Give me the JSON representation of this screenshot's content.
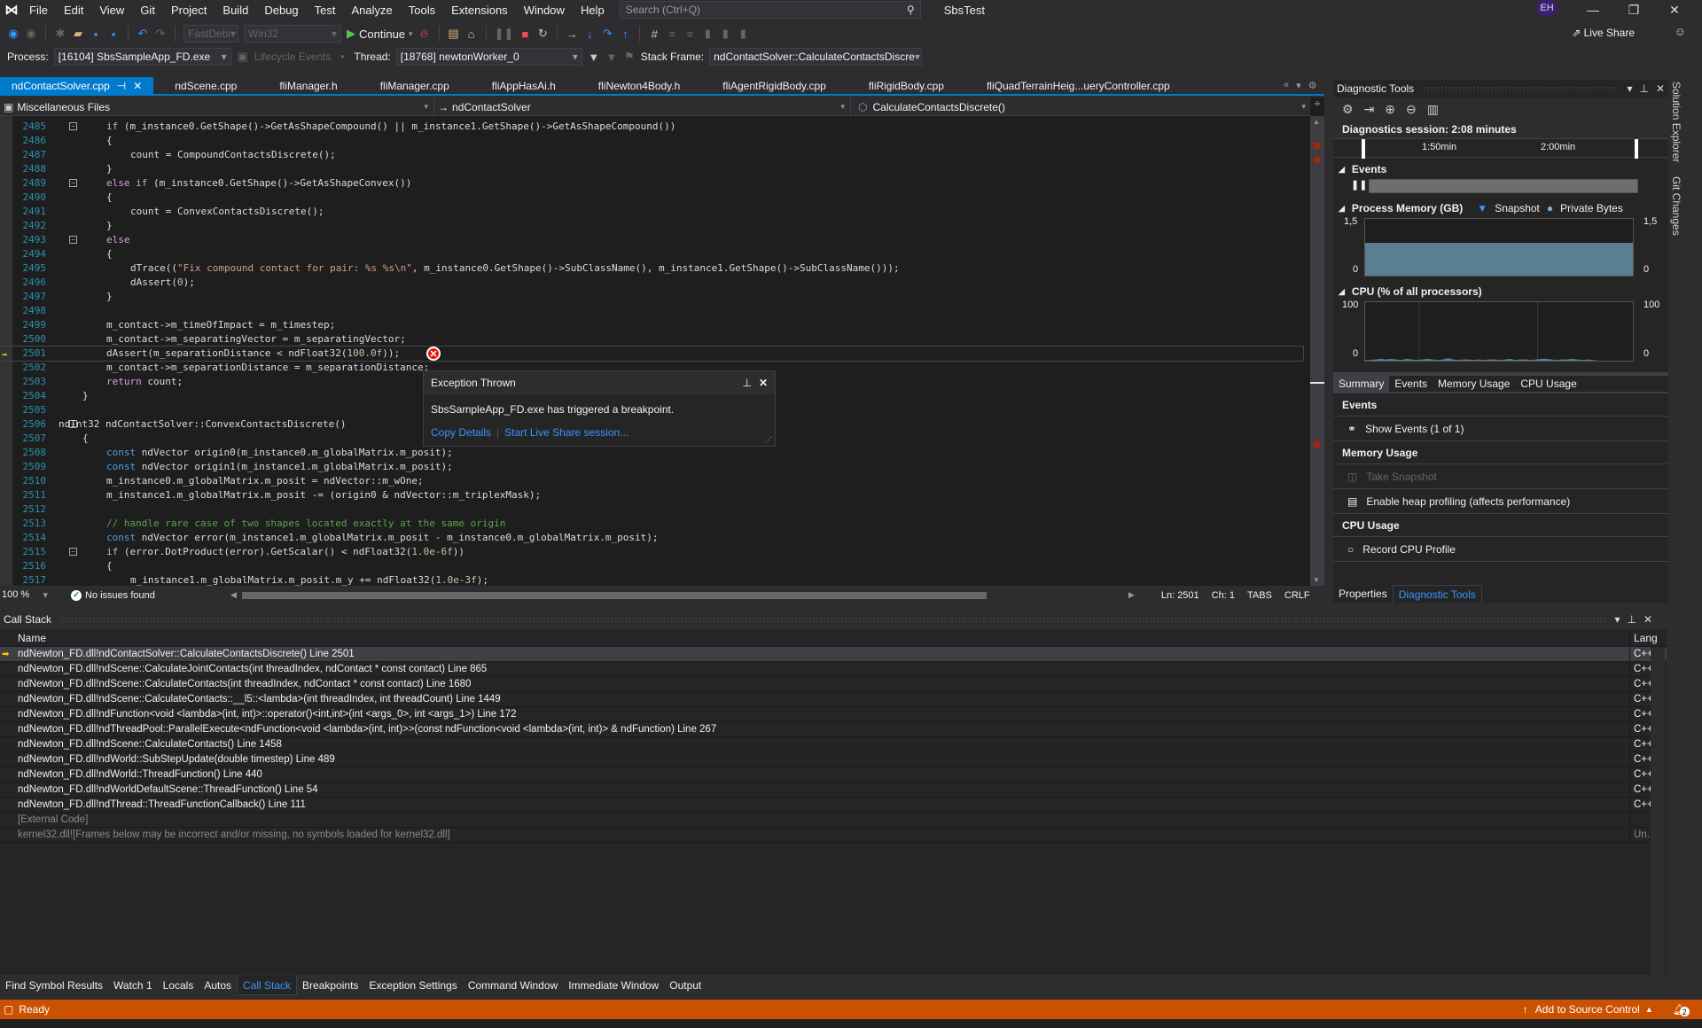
{
  "titlebar": {
    "menu": [
      "File",
      "Edit",
      "View",
      "Git",
      "Project",
      "Build",
      "Debug",
      "Test",
      "Analyze",
      "Tools",
      "Extensions",
      "Window",
      "Help"
    ],
    "search_placeholder": "Search (Ctrl+Q)",
    "solution_name": "SbsTest",
    "user_initials": "EH"
  },
  "toolbar": {
    "config": "FastDebi",
    "platform": "Win32",
    "continue_label": "Continue",
    "live_share": "Live Share",
    "process_label": "Process:",
    "process_value": "[16104] SbsSampleApp_FD.exe",
    "lifecycle_label": "Lifecycle Events",
    "thread_label": "Thread:",
    "thread_value": "[18768] newtonWorker_0",
    "stack_frame_label": "Stack Frame:",
    "stack_frame_value": "ndContactSolver::CalculateContactsDiscre"
  },
  "doc_tabs": [
    {
      "label": "ndContactSolver.cpp",
      "active": true
    },
    {
      "label": "ndScene.cpp"
    },
    {
      "label": "fliManager.h"
    },
    {
      "label": "fliManager.cpp"
    },
    {
      "label": "fliAppHasAi.h"
    },
    {
      "label": "fliNewton4Body.h"
    },
    {
      "label": "fliAgentRigidBody.cpp"
    },
    {
      "label": "fliRigidBody.cpp"
    },
    {
      "label": "fliQuadTerrainHeig...ueryController.cpp"
    }
  ],
  "navbar": {
    "project": "Miscellaneous Files",
    "scope": "ndContactSolver",
    "member": "CalculateContactsDiscrete()"
  },
  "editor": {
    "current_line": 2501,
    "lines": [
      {
        "n": "2485",
        "fold": "minus",
        "html": "<span class='ctl'>if</span> (m_instance0.GetShape()->GetAsShapeCompound() || m_instance1.GetShape()->GetAsShapeCompound())",
        "indent": 1
      },
      {
        "n": "2486",
        "html": "{",
        "indent": 1
      },
      {
        "n": "2487",
        "html": "count = CompoundContactsDiscrete();",
        "indent": 2
      },
      {
        "n": "2488",
        "html": "}",
        "indent": 1
      },
      {
        "n": "2489",
        "fold": "minus",
        "html": "<span class='ctl'>else if</span> (m_instance0.GetShape()->GetAsShapeConvex())",
        "indent": 1
      },
      {
        "n": "2490",
        "html": "{",
        "indent": 1
      },
      {
        "n": "2491",
        "html": "count = ConvexContactsDiscrete();",
        "indent": 2
      },
      {
        "n": "2492",
        "html": "}",
        "indent": 1
      },
      {
        "n": "2493",
        "fold": "minus",
        "html": "<span class='ctl'>else</span>",
        "indent": 1
      },
      {
        "n": "2494",
        "html": "{",
        "indent": 1
      },
      {
        "n": "2495",
        "html": "dTrace((<span class='str'>\"Fix compound contact for pair: %s %s\\n\"</span>, m_instance0.GetShape()->SubClassName(), m_instance1.GetShape()->SubClassName()));",
        "indent": 2
      },
      {
        "n": "2496",
        "html": "dAssert(<span class='num'>0</span>);",
        "indent": 2
      },
      {
        "n": "2497",
        "html": "}",
        "indent": 1
      },
      {
        "n": "2498",
        "html": "",
        "indent": 1
      },
      {
        "n": "2499",
        "html": "m_contact->m_timeOfImpact = m_timestep;",
        "indent": 1
      },
      {
        "n": "2500",
        "html": "m_contact->m_separatingVector = m_separatingVector;",
        "indent": 1
      },
      {
        "n": "2501",
        "html": "dAssert(m_separationDistance &lt; ndFloat32(<span class='num'>100.0f</span>));",
        "indent": 1,
        "current": true
      },
      {
        "n": "2502",
        "html": "m_contact->m_separationDistance = m_separationDistance;",
        "indent": 1
      },
      {
        "n": "2503",
        "html": "<span class='ctl'>return</span> count;",
        "indent": 1
      },
      {
        "n": "2504",
        "html": "}",
        "indent": 0
      },
      {
        "n": "2505",
        "html": "",
        "indent": 0
      },
      {
        "n": "2506",
        "fold": "minus",
        "html": "ndInt32 ndContactSolver::ConvexContactsDiscrete()",
        "indent": -1
      },
      {
        "n": "2507",
        "html": "{",
        "indent": 0
      },
      {
        "n": "2508",
        "html": "<span class='kw'>const</span> ndVector origin0(m_instance0.m_globalMatrix.m_posit);",
        "indent": 1
      },
      {
        "n": "2509",
        "html": "<span class='kw'>const</span> ndVector origin1(m_instance1.m_globalMatrix.m_posit);",
        "indent": 1
      },
      {
        "n": "2510",
        "html": "m_instance0.m_globalMatrix.m_posit = ndVector::m_wOne;",
        "indent": 1
      },
      {
        "n": "2511",
        "html": "m_instance1.m_globalMatrix.m_posit -= (origin0 &amp; ndVector::m_triplexMask);",
        "indent": 1
      },
      {
        "n": "2512",
        "html": "",
        "indent": 1
      },
      {
        "n": "2513",
        "html": "<span class='cm'>// handle rare case of two shapes located exactly at the same origin</span>",
        "indent": 1
      },
      {
        "n": "2514",
        "html": "<span class='kw'>const</span> ndVector error(m_instance1.m_globalMatrix.m_posit - m_instance0.m_globalMatrix.m_posit);",
        "indent": 1
      },
      {
        "n": "2515",
        "fold": "minus",
        "html": "<span class='ctl'>if</span> (error.DotProduct(error).GetScalar() &lt; ndFloat32(<span class='num'>1.0e-6f</span>))",
        "indent": 1
      },
      {
        "n": "2516",
        "html": "{",
        "indent": 1
      },
      {
        "n": "2517",
        "html": "m_instance1.m_globalMatrix.m_posit.m_y += ndFloat32(<span class='num'>1.0e-3f</span>);",
        "indent": 2
      }
    ]
  },
  "exception": {
    "title": "Exception Thrown",
    "message": "SbsSampleApp_FD.exe has triggered a breakpoint.",
    "copy_details": "Copy Details",
    "live_share_link": "Start Live Share session..."
  },
  "editor_status": {
    "zoom": "100 %",
    "issues": "No issues found",
    "ln": "Ln: 2501",
    "ch": "Ch: 1",
    "tabs": "TABS",
    "eol": "CRLF"
  },
  "diagnostics": {
    "title": "Diagnostic Tools",
    "session": "Diagnostics session: 2:08 minutes",
    "ruler_ticks": [
      "1:50min",
      "2:00min"
    ],
    "events_title": "Events",
    "memory_title": "Process Memory (GB)",
    "memory_legend": [
      "Snapshot",
      "Private Bytes"
    ],
    "memory_axis": {
      "max": "1,5",
      "min": "0"
    },
    "memory_level": 0.87,
    "cpu_title": "CPU (% of all processors)",
    "cpu_axis": {
      "max": "100",
      "min": "0"
    },
    "cpu_values": [
      4,
      4,
      5,
      6,
      5,
      6,
      5,
      4,
      6,
      5,
      4,
      5,
      6,
      5,
      4,
      5,
      7,
      5,
      4,
      5,
      5,
      4,
      5,
      4,
      5,
      5,
      4,
      5,
      6,
      4,
      5,
      5,
      4,
      5,
      6,
      6,
      5,
      4,
      5,
      5,
      6,
      5,
      4,
      5,
      4,
      3,
      0,
      0,
      0,
      0,
      0,
      1,
      0
    ],
    "tabs": [
      "Summary",
      "Events",
      "Memory Usage",
      "CPU Usage"
    ],
    "sections": [
      {
        "title": "Events",
        "actions": [
          {
            "label": "Show Events (1 of 1)",
            "icon": "events-icon"
          }
        ]
      },
      {
        "title": "Memory Usage",
        "actions": [
          {
            "label": "Take Snapshot",
            "icon": "camera-icon",
            "disabled": true
          },
          {
            "label": "Enable heap profiling (affects performance)",
            "icon": "memory-chip-icon"
          }
        ]
      },
      {
        "title": "CPU Usage",
        "actions": [
          {
            "label": "Record CPU Profile",
            "icon": "record-icon"
          }
        ]
      }
    ],
    "bottom_tabs": [
      "Properties",
      "Diagnostic Tools"
    ]
  },
  "side_tabs": [
    "Solution Explorer",
    "Git Changes"
  ],
  "callstack": {
    "title": "Call Stack",
    "col_name": "Name",
    "col_lang": "Lang",
    "rows": [
      {
        "name": "ndNewton_FD.dll!ndContactSolver::CalculateContactsDiscrete() Line 2501",
        "lang": "C++",
        "current": true
      },
      {
        "name": "ndNewton_FD.dll!ndScene::CalculateJointContacts(int threadIndex, ndContact * const contact) Line 865",
        "lang": "C++"
      },
      {
        "name": "ndNewton_FD.dll!ndScene::CalculateContacts(int threadIndex, ndContact * const contact) Line 1680",
        "lang": "C++"
      },
      {
        "name": "ndNewton_FD.dll!ndScene::CalculateContacts::__l5::<lambda>(int threadIndex, int threadCount) Line 1449",
        "lang": "C++"
      },
      {
        "name": "ndNewton_FD.dll!ndFunction<void <lambda>(int, int)>::operator()<int,int>(int <args_0>, int <args_1>) Line 172",
        "lang": "C++"
      },
      {
        "name": "ndNewton_FD.dll!ndThreadPool::ParallelExecute<ndFunction<void <lambda>(int, int)>>(const ndFunction<void <lambda>(int, int)> & ndFunction) Line 267",
        "lang": "C++"
      },
      {
        "name": "ndNewton_FD.dll!ndScene::CalculateContacts() Line 1458",
        "lang": "C++"
      },
      {
        "name": "ndNewton_FD.dll!ndWorld::SubStepUpdate(double timestep) Line 489",
        "lang": "C++"
      },
      {
        "name": "ndNewton_FD.dll!ndWorld::ThreadFunction() Line 440",
        "lang": "C++"
      },
      {
        "name": "ndNewton_FD.dll!ndWorldDefaultScene::ThreadFunction() Line 54",
        "lang": "C++"
      },
      {
        "name": "ndNewton_FD.dll!ndThread::ThreadFunctionCallback() Line 111",
        "lang": "C++"
      },
      {
        "name": "[External Code]",
        "lang": "",
        "external": true
      },
      {
        "name": "kernel32.dll![Frames below may be incorrect and/or missing, no symbols loaded for kernel32.dll]",
        "lang": "Un...",
        "external": true
      }
    ]
  },
  "bottom_tabs": [
    {
      "label": "Find Symbol Results"
    },
    {
      "label": "Watch 1"
    },
    {
      "label": "Locals"
    },
    {
      "label": "Autos"
    },
    {
      "label": "Call Stack",
      "active": true
    },
    {
      "label": "Breakpoints"
    },
    {
      "label": "Exception Settings"
    },
    {
      "label": "Command Window"
    },
    {
      "label": "Immediate Window"
    },
    {
      "label": "Output"
    }
  ],
  "statusbar": {
    "ready": "Ready",
    "source_control": "Add to Source Control",
    "notifications": "2"
  },
  "colors": {
    "accent": "#007acc",
    "status": "#ca5100",
    "link": "#3794ff",
    "memory_fill": "#5a7f93"
  }
}
